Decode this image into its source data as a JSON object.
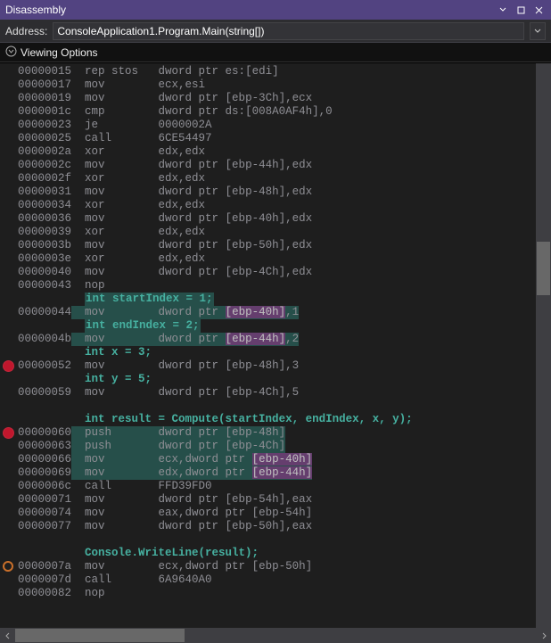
{
  "window": {
    "title": "Disassembly"
  },
  "addressbar": {
    "label": "Address:",
    "value": "ConsoleApplication1.Program.Main(string[])"
  },
  "options": {
    "label": "Viewing Options"
  },
  "breakpoints": [
    {
      "address": "00000052",
      "type": "solid"
    },
    {
      "address": "00000060",
      "type": "solid"
    },
    {
      "address": "0000007a",
      "type": "ring"
    }
  ],
  "lines": [
    {
      "t": "asm",
      "addr": "00000015",
      "ins": "rep stos",
      "ops": "dword ptr es:[edi]"
    },
    {
      "t": "asm",
      "addr": "00000017",
      "ins": "mov",
      "ops": "ecx,esi"
    },
    {
      "t": "asm",
      "addr": "00000019",
      "ins": "mov",
      "ops": "dword ptr [ebp-3Ch],ecx"
    },
    {
      "t": "asm",
      "addr": "0000001c",
      "ins": "cmp",
      "ops": "dword ptr ds:[008A0AF4h],0"
    },
    {
      "t": "asm",
      "addr": "00000023",
      "ins": "je",
      "ops": "0000002A"
    },
    {
      "t": "asm",
      "addr": "00000025",
      "ins": "call",
      "ops": "6CE54497"
    },
    {
      "t": "asm",
      "addr": "0000002a",
      "ins": "xor",
      "ops": "edx,edx"
    },
    {
      "t": "asm",
      "addr": "0000002c",
      "ins": "mov",
      "ops": "dword ptr [ebp-44h],edx"
    },
    {
      "t": "asm",
      "addr": "0000002f",
      "ins": "xor",
      "ops": "edx,edx"
    },
    {
      "t": "asm",
      "addr": "00000031",
      "ins": "mov",
      "ops": "dword ptr [ebp-48h],edx"
    },
    {
      "t": "asm",
      "addr": "00000034",
      "ins": "xor",
      "ops": "edx,edx"
    },
    {
      "t": "asm",
      "addr": "00000036",
      "ins": "mov",
      "ops": "dword ptr [ebp-40h],edx"
    },
    {
      "t": "asm",
      "addr": "00000039",
      "ins": "xor",
      "ops": "edx,edx"
    },
    {
      "t": "asm",
      "addr": "0000003b",
      "ins": "mov",
      "ops": "dword ptr [ebp-50h],edx"
    },
    {
      "t": "asm",
      "addr": "0000003e",
      "ins": "xor",
      "ops": "edx,edx"
    },
    {
      "t": "asm",
      "addr": "00000040",
      "ins": "mov",
      "ops": "dword ptr [ebp-4Ch],edx"
    },
    {
      "t": "asm",
      "addr": "00000043",
      "ins": "nop",
      "ops": ""
    },
    {
      "t": "src-hl",
      "text": "int startIndex = 1;"
    },
    {
      "t": "asm-hl",
      "addr": "00000044",
      "ins": "mov",
      "ops": "dword ptr ",
      "mem": "[ebp-40h]",
      "tail": ",1"
    },
    {
      "t": "src-hl",
      "text": "int endIndex = 2;"
    },
    {
      "t": "asm-hl",
      "addr": "0000004b",
      "ins": "mov",
      "ops": "dword ptr ",
      "mem": "[ebp-44h]",
      "tail": ",2"
    },
    {
      "t": "src",
      "text": "int x = 3;"
    },
    {
      "t": "asm",
      "addr": "00000052",
      "ins": "mov",
      "ops": "dword ptr [ebp-48h],3"
    },
    {
      "t": "src",
      "text": "int y = 5;"
    },
    {
      "t": "asm",
      "addr": "00000059",
      "ins": "mov",
      "ops": "dword ptr [ebp-4Ch],5"
    },
    {
      "t": "blank"
    },
    {
      "t": "src",
      "text": "int result = Compute(startIndex, endIndex, x, y);"
    },
    {
      "t": "asm-hl2",
      "addr": "00000060",
      "ins": "push",
      "ops": "dword ptr [ebp-48h]"
    },
    {
      "t": "asm-hl2",
      "addr": "00000063",
      "ins": "push",
      "ops": "dword ptr [ebp-4Ch]"
    },
    {
      "t": "asm-hl",
      "addr": "00000066",
      "ins": "mov",
      "ops": "ecx,dword ptr ",
      "mem": "[ebp-40h]",
      "tail": ""
    },
    {
      "t": "asm-hl",
      "addr": "00000069",
      "ins": "mov",
      "ops": "edx,dword ptr ",
      "mem": "[ebp-44h]",
      "tail": ""
    },
    {
      "t": "asm",
      "addr": "0000006c",
      "ins": "call",
      "ops": "FFD39FD0"
    },
    {
      "t": "asm",
      "addr": "00000071",
      "ins": "mov",
      "ops": "dword ptr [ebp-54h],eax"
    },
    {
      "t": "asm",
      "addr": "00000074",
      "ins": "mov",
      "ops": "eax,dword ptr [ebp-54h]"
    },
    {
      "t": "asm",
      "addr": "00000077",
      "ins": "mov",
      "ops": "dword ptr [ebp-50h],eax"
    },
    {
      "t": "blank"
    },
    {
      "t": "src",
      "text": "Console.WriteLine(result);"
    },
    {
      "t": "asm",
      "addr": "0000007a",
      "ins": "mov",
      "ops": "ecx,dword ptr [ebp-50h]"
    },
    {
      "t": "asm",
      "addr": "0000007d",
      "ins": "call",
      "ops": "6A9640A0"
    },
    {
      "t": "asm",
      "addr": "00000082",
      "ins": "nop",
      "ops": ""
    }
  ]
}
